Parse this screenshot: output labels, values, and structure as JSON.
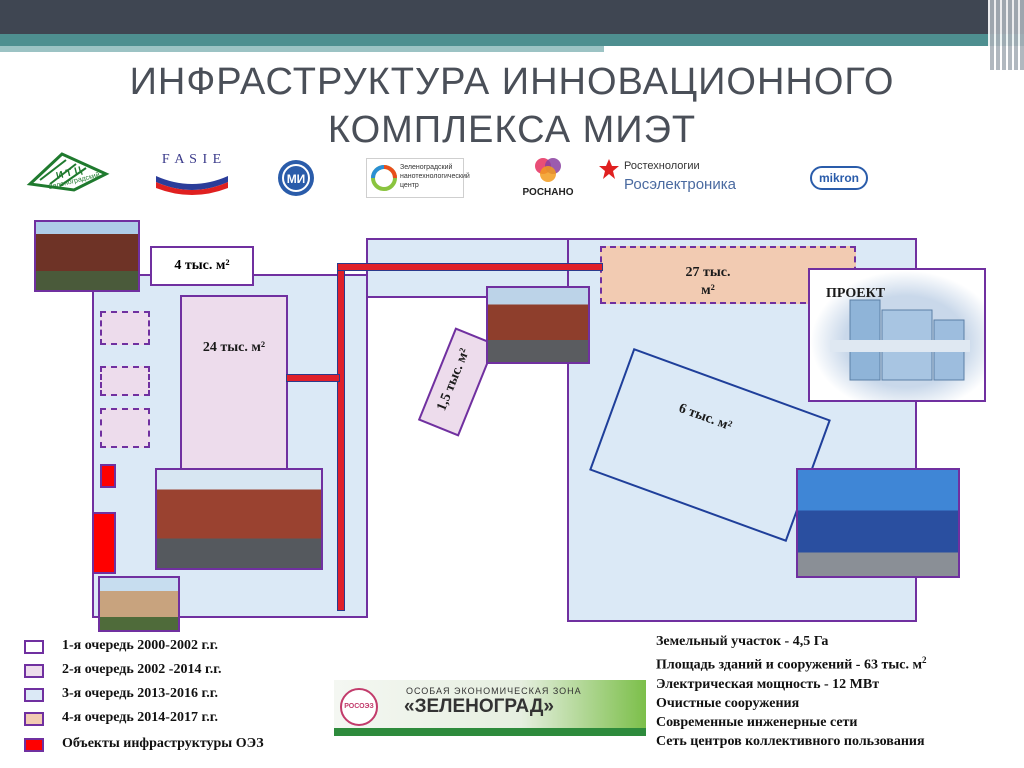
{
  "title": {
    "line1": "ИНФРАСТРУКТУРА ИННОВАЦИОННОГО",
    "line2": "КОМПЛЕКСА МИЭТ"
  },
  "logos": {
    "itc": "И Т Ц",
    "itc_sub": "Зеленоградский",
    "fasie": "F A S I E",
    "nano_center": "Зеленоградский нанотехнологический центр",
    "rosnano": "РОСНАНО",
    "rostech": "Ростехнологии",
    "roselectronika": "Росэлектроника",
    "mikron": "mikron"
  },
  "map": {
    "label_4k": "4 тыс. м²",
    "label_24k": "24 тыс. м²",
    "label_27k_a": "27 тыс.",
    "label_27k_b": "м²",
    "label_1_5k": "1,5 тыс. м²",
    "label_6k": "6 тыс. м²",
    "label_project": "ПРОЕКТ"
  },
  "legend": [
    {
      "text": "1-я очередь  2000-2002 г.г.",
      "color": "#ffffff"
    },
    {
      "text": "2-я очередь  2002 -2014 г.г.",
      "color": "#eddcec"
    },
    {
      "text": "3-я очередь  2013-2016 г.г.",
      "color": "#dbe9f6"
    },
    {
      "text": "4-я очередь  2014-2017 г.г.",
      "color": "#f2cbb2"
    },
    {
      "text": "Объекты инфраструктуры ОЭЗ",
      "color": "#ff0000"
    }
  ],
  "banner": {
    "top": "ОСОБАЯ ЭКОНОМИЧЕСКАЯ ЗОНА",
    "main": "«ЗЕЛЕНОГРАД»",
    "badge": "РОСОЭЗ"
  },
  "facts": {
    "line1": "Земельный участок - 4,5 Га",
    "line2": "Площадь зданий и сооружений - 63  тыс. м",
    "line2_sup": "2",
    "line3": "Электрическая мощность  - 12 МВт",
    "line4": "Очистные сооружения",
    "line5": "Современные инженерные сети",
    "line6": "Сеть центров коллективного пользования"
  }
}
